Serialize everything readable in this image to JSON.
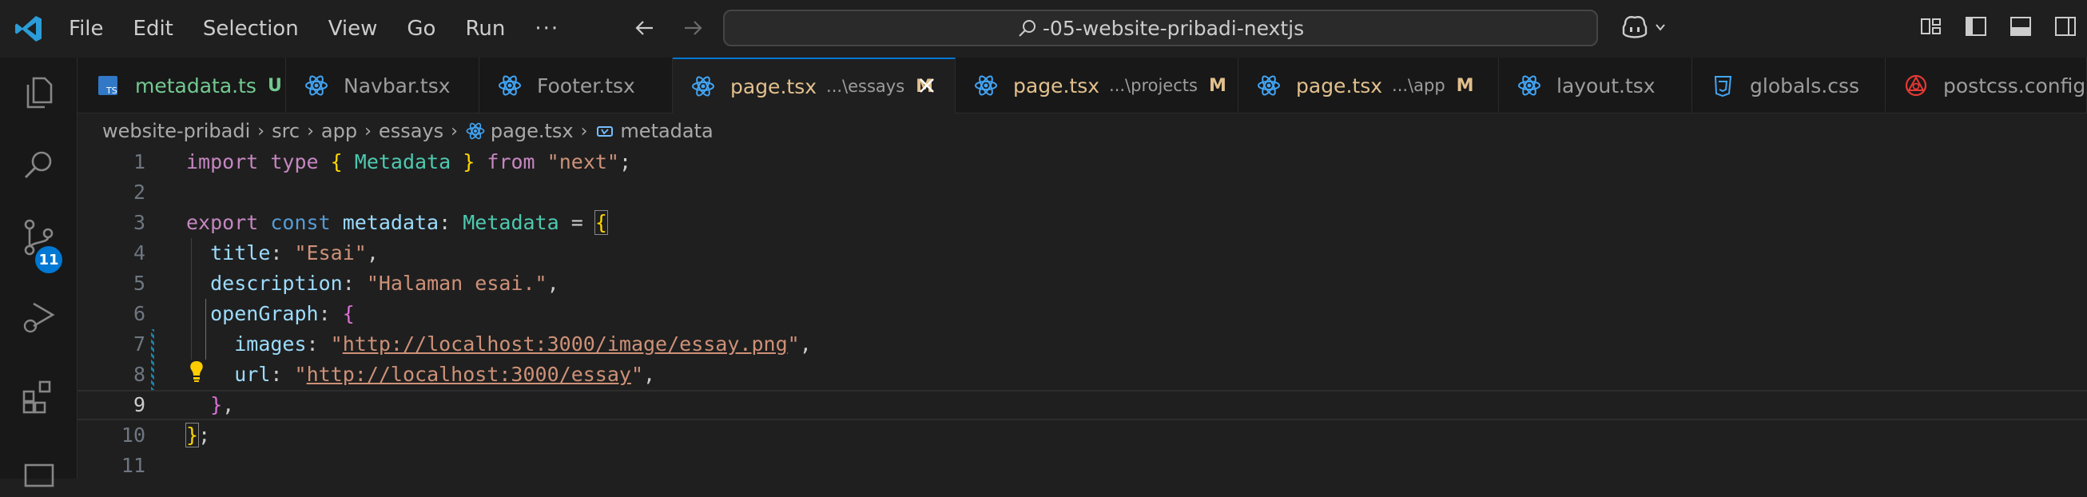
{
  "menu": [
    "File",
    "Edit",
    "Selection",
    "View",
    "Go",
    "Run",
    "···"
  ],
  "command_center": {
    "text": "-05-website-pribadi-nextjs"
  },
  "activity_bar": {
    "source_control_badge": "11"
  },
  "tabs": [
    {
      "label": "metadata.ts",
      "desc": "",
      "status": "U",
      "icon": "typescript-icon",
      "state": "untracked"
    },
    {
      "label": "Navbar.tsx",
      "desc": "",
      "status": "",
      "icon": "react-icon",
      "state": "normal"
    },
    {
      "label": "Footer.tsx",
      "desc": "",
      "status": "",
      "icon": "react-icon",
      "state": "normal"
    },
    {
      "label": "page.tsx",
      "desc": "...\\essays",
      "status": "M",
      "icon": "react-icon",
      "state": "active"
    },
    {
      "label": "page.tsx",
      "desc": "...\\projects",
      "status": "M",
      "icon": "react-icon",
      "state": "modified"
    },
    {
      "label": "page.tsx",
      "desc": "...\\app",
      "status": "M",
      "icon": "react-icon",
      "state": "modified"
    },
    {
      "label": "layout.tsx",
      "desc": "",
      "status": "",
      "icon": "react-icon",
      "state": "normal"
    },
    {
      "label": "globals.css",
      "desc": "",
      "status": "",
      "icon": "css-icon",
      "state": "normal"
    },
    {
      "label": "postcss.config.m",
      "desc": "",
      "status": "",
      "icon": "postcss-icon",
      "state": "normal"
    }
  ],
  "breadcrumbs": [
    "website-pribadi",
    "src",
    "app",
    "essays",
    "page.tsx",
    "metadata"
  ],
  "code": {
    "line_numbers": [
      "1",
      "2",
      "3",
      "4",
      "5",
      "6",
      "7",
      "8",
      "9",
      "10",
      "11"
    ],
    "l1": {
      "import": "import",
      "type": "type",
      "ob": "{",
      "Metadata": "Metadata",
      "cb": "}",
      "from": "from",
      "next": "\"next\"",
      "semi": ";"
    },
    "l3": {
      "export": "export",
      "const": "const",
      "name": "metadata",
      "colon": ":",
      "type": "Metadata",
      "eq": "=",
      "ob": "{"
    },
    "l4": {
      "key": "title",
      "colon": ":",
      "val": "\"Esai\"",
      "comma": ","
    },
    "l5": {
      "key": "description",
      "colon": ":",
      "val": "\"Halaman esai.\"",
      "comma": ","
    },
    "l6": {
      "key": "openGraph",
      "colon": ":",
      "ob": "{"
    },
    "l7": {
      "key": "images",
      "colon": ":",
      "q1": "\"",
      "url": "http://localhost:3000/image/essay.png",
      "q2": "\"",
      "comma": ","
    },
    "l8": {
      "key": "url",
      "colon": ":",
      "q1": "\"",
      "url": "http://localhost:3000/essay",
      "q2": "\"",
      "comma": ","
    },
    "l9": {
      "cb": "}",
      "comma": ","
    },
    "l10": {
      "cb": "}",
      "semi": ";"
    }
  }
}
